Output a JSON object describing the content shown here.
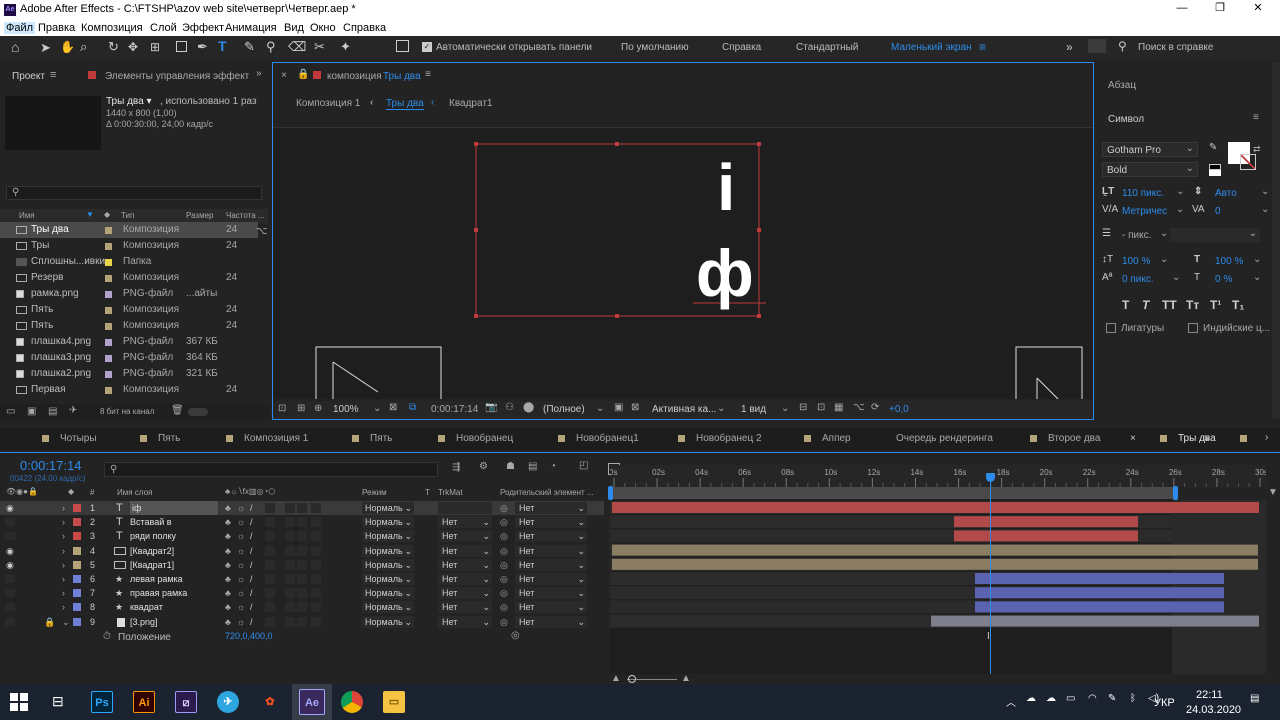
{
  "window": {
    "title": "Adobe After Effects - C:\\FTSHP\\azov web site\\четверг\\Четверг.aep *"
  },
  "menu": [
    "Файл",
    "Правка",
    "Композиция",
    "Слой",
    "Эффект",
    "Анимация",
    "Вид",
    "Окно",
    "Справка"
  ],
  "toolbar": {
    "auto_open": "Автоматически открывать панели",
    "workspaces": [
      "По умолчанию",
      "Справка",
      "Стандартный",
      "Маленький экран"
    ],
    "search_placeholder": "Поиск в справке"
  },
  "project": {
    "tab_project": "Проект",
    "tab_effects": "Элементы управления эффект",
    "item_name": "Тры два ▾",
    "item_used": ", использовано 1 раз",
    "item_size": "1440 x 800 (1,00)",
    "item_duration": "Δ 0:00:30:00, 24,00 кадр/с",
    "columns": [
      "Имя",
      "Тип",
      "Размер",
      "Частота ..."
    ],
    "items": [
      {
        "name": "Тры два",
        "type": "Композиция",
        "size": "",
        "rate": "24",
        "color": "#b5a47a"
      },
      {
        "name": "Тры",
        "type": "Композиция",
        "size": "",
        "rate": "24",
        "color": "#b5a47a"
      },
      {
        "name": "Сплошны...ивки",
        "type": "Папка",
        "size": "",
        "rate": "",
        "color": "#e8d44a"
      },
      {
        "name": "Резерв",
        "type": "Композиция",
        "size": "",
        "rate": "24",
        "color": "#b5a47a"
      },
      {
        "name": "рамка.png",
        "type": "PNG-файл",
        "size": "...айты",
        "rate": "",
        "color": "#b1a2cf"
      },
      {
        "name": "Пять",
        "type": "Композиция",
        "size": "",
        "rate": "24",
        "color": "#b5a47a"
      },
      {
        "name": "Пять",
        "type": "Композиция",
        "size": "",
        "rate": "24",
        "color": "#b5a47a"
      },
      {
        "name": "плашка4.png",
        "type": "PNG-файл",
        "size": "367 КБ",
        "rate": "",
        "color": "#b1a2cf"
      },
      {
        "name": "плашка3.png",
        "type": "PNG-файл",
        "size": "364 КБ",
        "rate": "",
        "color": "#b1a2cf"
      },
      {
        "name": "плашка2.png",
        "type": "PNG-файл",
        "size": "321 КБ",
        "rate": "",
        "color": "#b1a2cf"
      },
      {
        "name": "Первая",
        "type": "Композиция",
        "size": "",
        "rate": "24",
        "color": "#b5a47a"
      }
    ],
    "bitdepth": "8 бит на канал"
  },
  "composition": {
    "panel_title": "композиция",
    "comp_name": "Тры два",
    "breadcrumbs": [
      "Композиция 1",
      "Тры два",
      "Квадрат1"
    ],
    "canvas_text_1": "і",
    "canvas_text_2": "ф",
    "zoom": "100%",
    "timecode": "0:00:17:14",
    "resolution": "(Полное)",
    "camera": "Активная ка...",
    "views": "1 вид",
    "exposure": "+0,0"
  },
  "character": {
    "tab_paragraph": "Абзац",
    "tab_character": "Символ",
    "font": "Gotham Pro",
    "style": "Bold",
    "size": "110 пикс.",
    "leading": "Авто",
    "kerning": "Метричес",
    "tracking": "0",
    "stroke": "- пикс.",
    "vscale": "100 %",
    "hscale": "100 %",
    "baseline": "0 пикс.",
    "tsume": "0 %",
    "ligatures": "Лигатуры",
    "hindi": "Индийские ц..."
  },
  "timeline": {
    "tabs": [
      "Чотыры",
      "Пять",
      "Композиция 1",
      "Пять",
      "Новобранец",
      "Новобранец1",
      "Новобранец 2",
      "Аппер",
      "Очередь рендеринга",
      "Второе два",
      "Тры два"
    ],
    "timecode": "0:00:17:14",
    "frames": "00422 (24.00 кадр/с)",
    "columns": {
      "name": "Имя слоя",
      "mode": "Режим",
      "t": "T",
      "trkmat": "TrkMat",
      "parent": "Родительский элемент ..."
    },
    "ruler": [
      "0s",
      "02s",
      "04s",
      "06s",
      "08s",
      "10s",
      "12s",
      "14s",
      "16s",
      "18s",
      "20s",
      "22s",
      "24s",
      "26s",
      "28s",
      "30s"
    ],
    "layers": [
      {
        "num": "1",
        "name": "іф",
        "icon": "T",
        "color": "#c84b4b",
        "mode": "Нормаль",
        "trk": "",
        "parent": "Нет",
        "eye": true
      },
      {
        "num": "2",
        "name": "Вставай в",
        "icon": "T",
        "color": "#c84b4b",
        "mode": "Нормаль",
        "trk": "Нет",
        "parent": "Нет",
        "eye": false
      },
      {
        "num": "3",
        "name": "ряди полку",
        "icon": "T",
        "color": "#c84b4b",
        "mode": "Нормаль",
        "trk": "Нет",
        "parent": "Нет",
        "eye": false
      },
      {
        "num": "4",
        "name": "[Квадрат2]",
        "icon": "comp",
        "color": "#b5a47a",
        "mode": "Нормаль",
        "trk": "Нет",
        "parent": "Нет",
        "eye": true
      },
      {
        "num": "5",
        "name": "[Квадрат1]",
        "icon": "comp",
        "color": "#b5a47a",
        "mode": "Нормаль",
        "trk": "Нет",
        "parent": "Нет",
        "eye": true
      },
      {
        "num": "6",
        "name": "левая рамка",
        "icon": "★",
        "color": "#6f7fd6",
        "mode": "Нормаль",
        "trk": "Нет",
        "parent": "Нет",
        "eye": false
      },
      {
        "num": "7",
        "name": "правая рамка",
        "icon": "★",
        "color": "#6f7fd6",
        "mode": "Нормаль",
        "trk": "Нет",
        "parent": "Нет",
        "eye": false
      },
      {
        "num": "8",
        "name": "квадрат",
        "icon": "★",
        "color": "#6f7fd6",
        "mode": "Нормаль",
        "trk": "Нет",
        "parent": "Нет",
        "eye": false
      },
      {
        "num": "9",
        "name": "[3.png]",
        "icon": "img",
        "color": "#6f7fd6",
        "mode": "Нормаль",
        "trk": "Нет",
        "parent": "Нет",
        "eye": false
      }
    ],
    "property_name": "Положение",
    "property_value": "720,0,400,0"
  },
  "taskbar": {
    "apps": [
      "Ps",
      "Ai",
      "Pr",
      "Tg",
      "Fg",
      "Ae",
      "Ch",
      "Ex"
    ],
    "lang": "УКР",
    "time": "22:11",
    "date": "24.03.2020"
  }
}
